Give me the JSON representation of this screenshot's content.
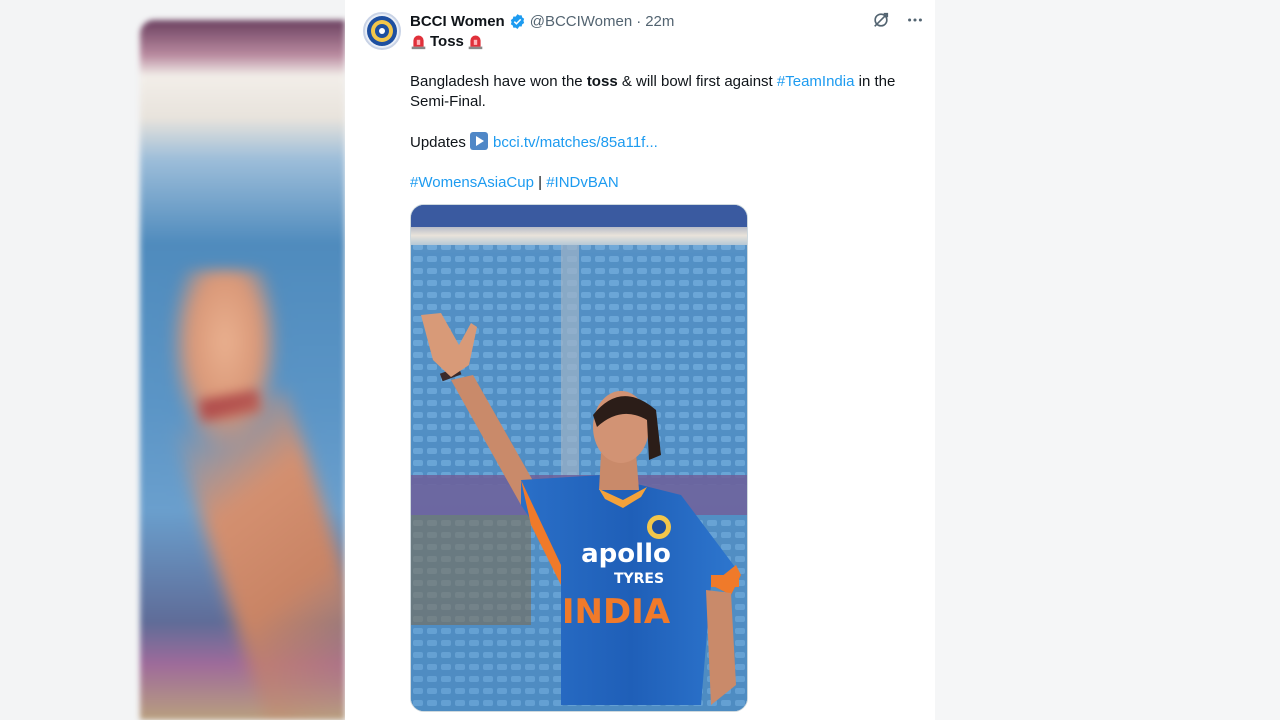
{
  "tweet": {
    "author_name": "BCCI Women",
    "author_handle": "@BCCIWomen",
    "separator": "·",
    "time": "22m",
    "title": "Toss",
    "text": {
      "line1_before": "Bangladesh have won the ",
      "line1_bold": "toss",
      "line1_after": " & will bowl first against ",
      "line1_hashtag": "#TeamIndia",
      "line1_end": " in the Semi-Final.",
      "updates_label": "Updates",
      "updates_link": "bcci.tv/matches/85a11f...",
      "hashtag1": "#WomensAsiaCup",
      "hashtag_sep": " | ",
      "hashtag2": "#INDvBAN"
    },
    "media": {
      "jersey_sponsor_top": "apollo",
      "jersey_sponsor_bottom": "TYRES",
      "jersey_country": "INDIA"
    }
  },
  "colors": {
    "link": "#1d9bf0",
    "verified": "#1d9bf0",
    "jersey_blue": "#1f5fb8",
    "jersey_orange": "#f07a2a"
  },
  "icons": [
    "grok-icon",
    "more-icon",
    "verified-badge-icon",
    "siren-icon",
    "play-icon"
  ]
}
